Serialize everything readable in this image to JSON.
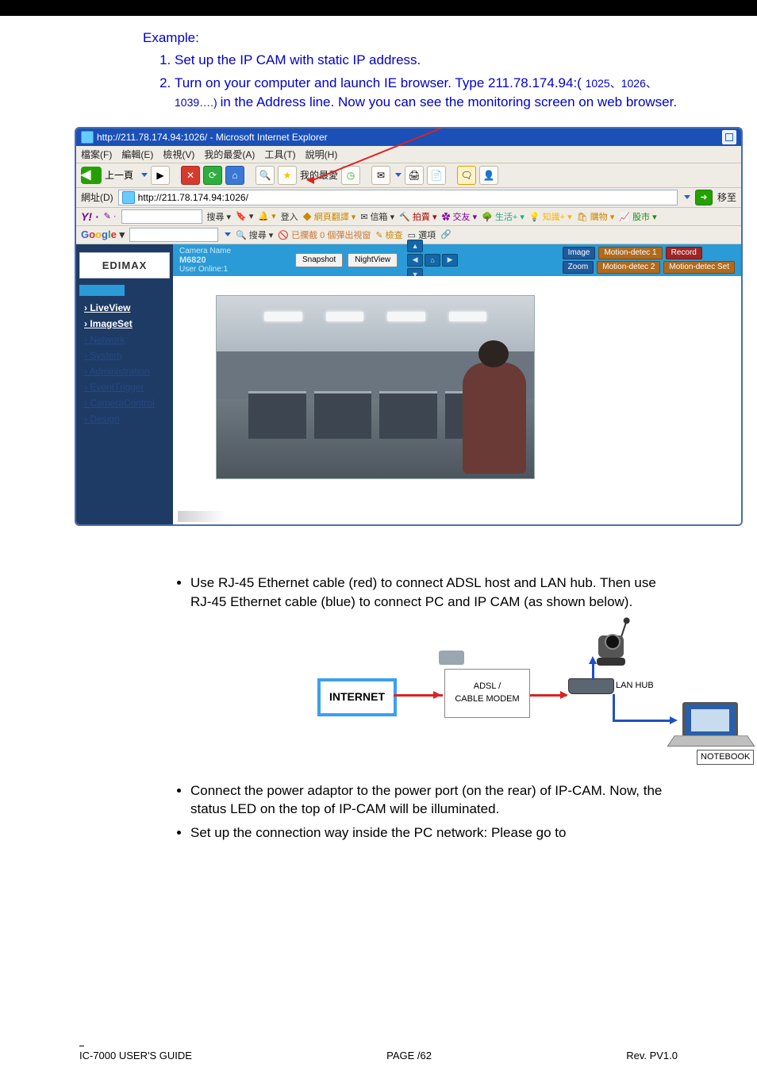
{
  "example": {
    "heading": "Example:",
    "steps": [
      "Set up the IP CAM with static IP address."
    ],
    "step2": {
      "a": "Turn on your computer and launch IE browser. Type 211.78.174.94:(",
      "ports": " 1025、1026、1039….) ",
      "b": "in the Address line. Now you can see the monitoring screen on web browser."
    }
  },
  "screenshot": {
    "window_title": "http://211.78.174.94:1026/ - Microsoft Internet Explorer",
    "menus": [
      "檔案(F)",
      "編輯(E)",
      "檢視(V)",
      "我的最愛(A)",
      "工具(T)",
      "說明(H)"
    ],
    "toolbar": {
      "back": "上一頁",
      "favorites": "我的最愛"
    },
    "address": {
      "label": "網址(D)",
      "url": "http://211.78.174.94:1026/",
      "go": "移至"
    },
    "yahoo": {
      "items": [
        "搜尋",
        "登入",
        "網頁翻譯",
        "信箱",
        "拍賣",
        "交友",
        "生活+",
        "知識+",
        "購物",
        "股市"
      ]
    },
    "google": {
      "items": [
        "搜尋",
        "已攔截 0 個彈出視窗",
        "檢查",
        "選項"
      ]
    },
    "app": {
      "brand": "EDIMAX",
      "side": [
        "LiveView",
        "ImageSet",
        "Network",
        "System",
        "Administration",
        "EventTrigger",
        "CameraControl",
        "Design"
      ],
      "header": {
        "cam_label": "Camera Name",
        "cam_value": "M6820",
        "user_online": "User Online:1",
        "btn_snapshot": "Snapshot",
        "btn_nightview": "NightView",
        "right": [
          "Image",
          "Motion-detec 1",
          "Record",
          "Zoom",
          "Motion-detec 2",
          "Motion-detec Set"
        ]
      }
    }
  },
  "bullets": [
    "Use RJ-45 Ethernet cable (red) to connect ADSL host and LAN hub. Then use RJ-45 Ethernet cable (blue) to connect PC and IP CAM (as shown below).",
    "Connect the power adaptor to the power port (on the rear) of IP-CAM. Now, the status LED on the top of IP-CAM will be illuminated.",
    "Set up the connection way inside the PC network: Please go to"
  ],
  "diagram": {
    "internet": "INTERNET",
    "modem": [
      "ADSL /",
      "CABLE MODEM"
    ],
    "hub": "LAN HUB",
    "notebook": "NOTEBOOK"
  },
  "footer": {
    "left": "IC-7000 USER'S GUIDE",
    "center": "PAGE   /62",
    "right": "Rev. PV1.0"
  }
}
